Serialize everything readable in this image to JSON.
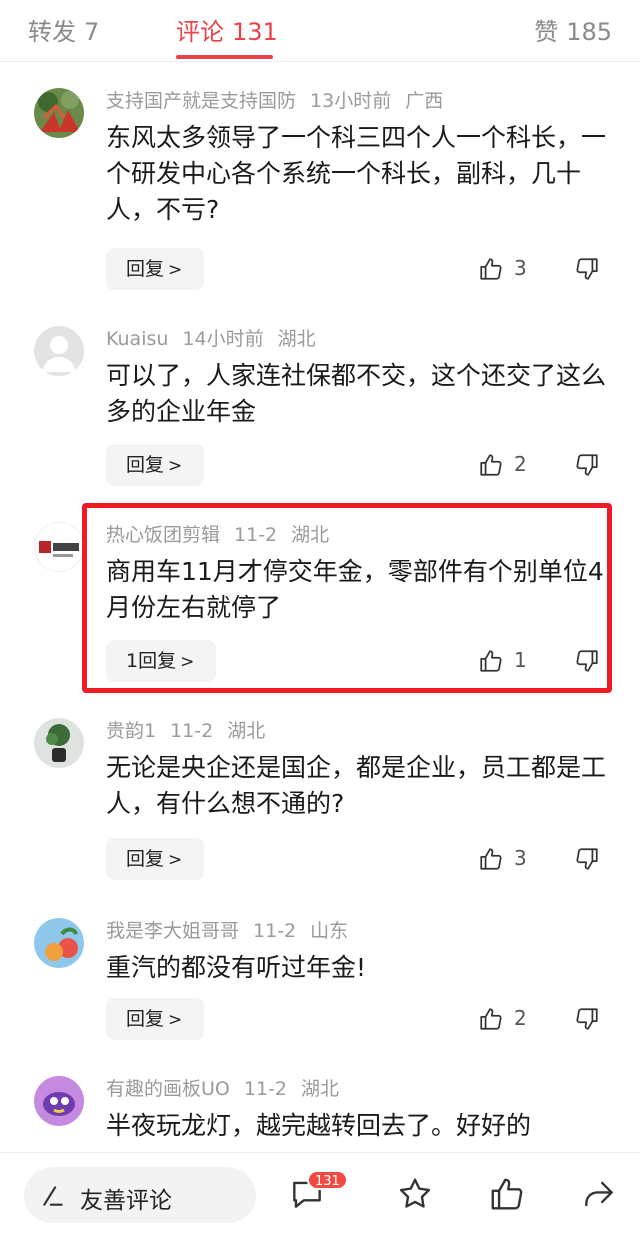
{
  "tabs": [
    {
      "label": "转发",
      "count": "7"
    },
    {
      "label": "评论",
      "count": "131"
    },
    {
      "label": "赞",
      "count": "185"
    }
  ],
  "accent_color": "#e9424a",
  "highlight_color": "#ee1b25",
  "comments": [
    {
      "user": "支持国产就是支持国防",
      "time": "13小时前",
      "location": "广西",
      "text": "东风太多领导了一个科三四个人一个科长，一个研发中心各个系统一个科长，副科，几十人，不亏?",
      "reply": "回复",
      "likes": "3"
    },
    {
      "user": "Kuaisu",
      "time": "14小时前",
      "location": "湖北",
      "text": "可以了，人家连社保都不交，这个还交了这么多的企业年金",
      "reply": "回复",
      "likes": "2"
    },
    {
      "user": "热心饭团剪辑",
      "time": "11-2",
      "location": "湖北",
      "text": "商用车11月才停交年金，零部件有个别单位4月份左右就停了",
      "reply": "1回复",
      "likes": "1"
    },
    {
      "user": "贵韵1",
      "time": "11-2",
      "location": "湖北",
      "text": "无论是央企还是国企，都是企业，员工都是工人，有什么想不通的?",
      "reply": "回复",
      "likes": "3"
    },
    {
      "user": "我是李大姐哥哥",
      "time": "11-2",
      "location": "山东",
      "text": "重汽的都没有听过年金!",
      "reply": "回复",
      "likes": "2"
    },
    {
      "user": "有趣的画板UO",
      "time": "11-2",
      "location": "湖北",
      "text": "半夜玩龙灯，越完越转回去了。好好的",
      "reply": "",
      "likes": ""
    }
  ],
  "avatar_logo_text": "热心饭团",
  "bottom": {
    "friendly_label": "友善评论",
    "comment_badge": "131",
    "icons": [
      "pen-icon",
      "comment-icon",
      "star-icon",
      "thumb-up-icon",
      "share-icon"
    ]
  }
}
